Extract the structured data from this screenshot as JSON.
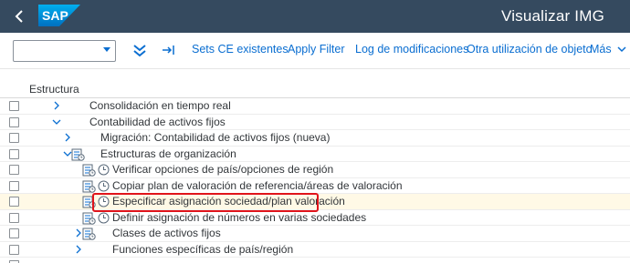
{
  "shell": {
    "back_icon": "back-arrow-icon",
    "logo_text": "SAP",
    "title": "Visualizar IMG"
  },
  "toolbar": {
    "select_value": "",
    "expand_icon": "expand-all-icon",
    "position_icon": "position-icon",
    "sets_ce": "Sets CE existentes",
    "apply_filter": "Apply Filter",
    "log": "Log de modificaciones",
    "otra": "Otra utilización de objeto",
    "mas": "Más"
  },
  "tree": {
    "header": "Estructura",
    "rows": [
      {
        "label": "Consolidación en tiempo real",
        "expander": "collapsed"
      },
      {
        "label": "Contabilidad de activos fijos",
        "expander": "expanded"
      },
      {
        "label": "Migración: Contabilidad de activos fijos (nueva)",
        "expander": "collapsed"
      },
      {
        "label": "Estructuras de organización",
        "expander": "expanded",
        "icon": "img-activity-icon"
      },
      {
        "label": "Verificar opciones de país/opciones de región",
        "icon": "img-activity-icon"
      },
      {
        "label": "Copiar plan de valoración de referencia/áreas de valoración",
        "icon": "img-activity-icon"
      },
      {
        "label": "Especificar asignación sociedad/plan valoración",
        "icon": "img-activity-icon",
        "highlighted": true
      },
      {
        "label": "Definir asignación de números en varias sociedades",
        "icon": "img-activity-icon"
      },
      {
        "label": "Clases de activos fijos",
        "expander": "collapsed",
        "icon": "img-activity-icon"
      },
      {
        "label": "Funciones específicas de país/región",
        "expander": "collapsed"
      }
    ]
  },
  "colors": {
    "shell_bg": "#354a5f",
    "link": "#0a6ed1",
    "highlight": "#e0141b",
    "selected_row": "#fff9e6"
  }
}
